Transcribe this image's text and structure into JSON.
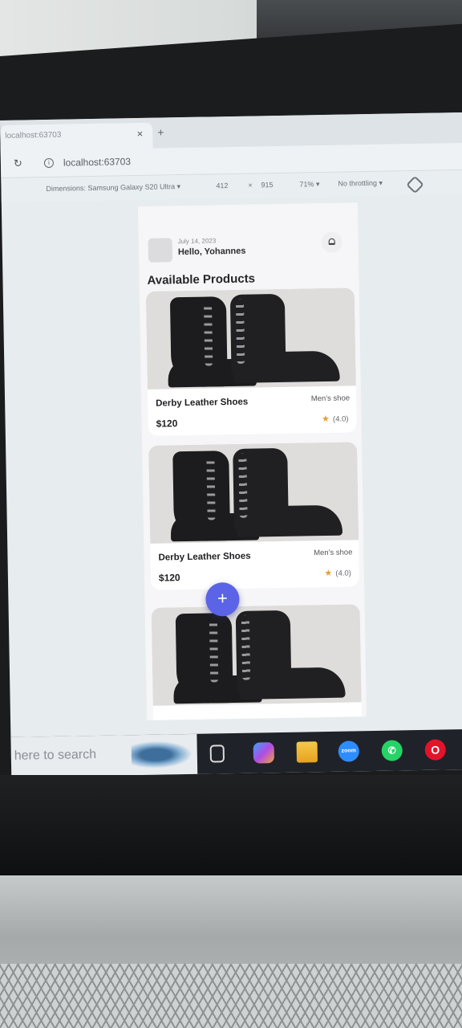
{
  "browser": {
    "tab_title": "localhost:63703",
    "url": "localhost:63703",
    "devtools": {
      "dimensions_label": "Dimensions: Samsung Galaxy S20 Ultra ▾",
      "width": "412",
      "separator": "×",
      "height": "915",
      "zoom": "71% ▾",
      "throttling": "No throttling ▾"
    }
  },
  "app": {
    "header": {
      "date": "July 14, 2023",
      "greeting": "Hello, Yohannes"
    },
    "section_title": "Available Products",
    "products": [
      {
        "name": "Derby Leather Shoes",
        "price": "$120",
        "category": "Men's shoe",
        "rating": "(4.0)"
      },
      {
        "name": "Derby Leather Shoes",
        "price": "$120",
        "category": "Men's shoe",
        "rating": "(4.0)"
      }
    ],
    "fab_label": "+"
  },
  "taskbar": {
    "search_placeholder": "here to search",
    "zoom_label": "zoom"
  },
  "colors": {
    "fab": "#5b63e6",
    "star": "#e0a23a"
  }
}
